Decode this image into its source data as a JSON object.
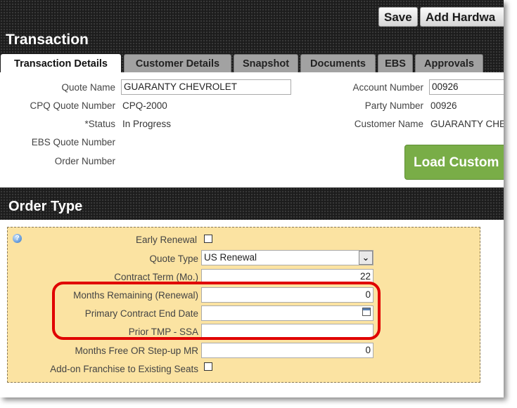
{
  "toolbar": {
    "save_label": "Save",
    "add_hardware_label": "Add Hardwa"
  },
  "page": {
    "title": "Transaction"
  },
  "tabs": [
    {
      "label": "Transaction Details"
    },
    {
      "label": "Customer Details"
    },
    {
      "label": "Snapshot"
    },
    {
      "label": "Documents"
    },
    {
      "label": "EBS"
    },
    {
      "label": "Approvals"
    }
  ],
  "details": {
    "quote_name_label": "Quote Name",
    "quote_name_value": "GUARANTY CHEVROLET",
    "cpq_quote_number_label": "CPQ Quote Number",
    "cpq_quote_number_value": "CPQ-2000",
    "status_label": "*Status",
    "status_value": "In Progress",
    "ebs_quote_number_label": "EBS Quote Number",
    "order_number_label": "Order Number",
    "account_number_label": "Account Number",
    "account_number_value": "00926",
    "party_number_label": "Party Number",
    "party_number_value": "00926",
    "customer_name_label": "Customer Name",
    "customer_name_value": "GUARANTY CHE",
    "load_customer_label": "Load Custom"
  },
  "order_type": {
    "title": "Order Type",
    "early_renewal_label": "Early Renewal",
    "early_renewal_checked": false,
    "quote_type_label": "Quote Type",
    "quote_type_value": "US Renewal",
    "contract_term_label": "Contract Term (Mo.)",
    "contract_term_value": "22",
    "months_remaining_label": "Months Remaining (Renewal)",
    "months_remaining_value": "0",
    "primary_contract_end_label": "Primary Contract End Date",
    "primary_contract_end_value": "",
    "prior_tmp_label": "Prior TMP - SSA",
    "prior_tmp_value": "",
    "months_free_label": "Months Free OR Step-up MR",
    "months_free_value": "0",
    "addon_franchise_label": "Add-on Franchise to Existing Seats",
    "addon_franchise_checked": false
  },
  "icons": {
    "help": "help-icon",
    "select_chevron": "chevron-down-icon",
    "date_picker": "calendar-icon"
  },
  "colors": {
    "header_bg": "#1c1c1c",
    "panel_bg": "#fbe3a2",
    "load_button": "#79ad47",
    "highlight": "#e00000"
  }
}
